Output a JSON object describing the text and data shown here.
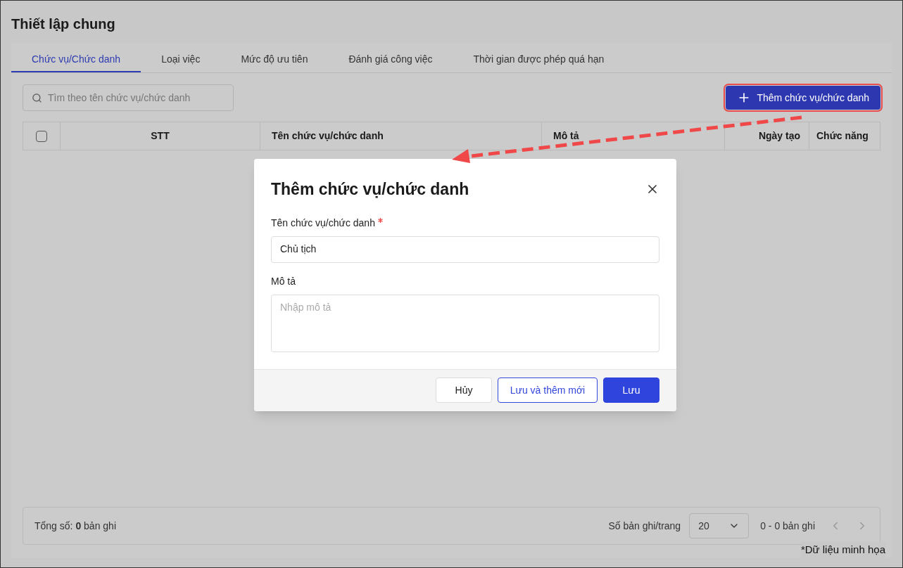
{
  "page_title": "Thiết lập chung",
  "tabs": [
    {
      "label": "Chức vụ/Chức danh",
      "selected": true
    },
    {
      "label": "Loại việc",
      "selected": false
    },
    {
      "label": "Mức độ ưu tiên",
      "selected": false
    },
    {
      "label": "Đánh giá công việc",
      "selected": false
    },
    {
      "label": "Thời gian được phép quá hạn",
      "selected": false
    }
  ],
  "search": {
    "placeholder": "Tìm theo tên chức vụ/chức danh"
  },
  "add_button": {
    "label": "Thêm chức vụ/chức danh",
    "highlighted": true
  },
  "table": {
    "select_all_checked": false,
    "columns": [
      {
        "label": "STT"
      },
      {
        "label": "Tên chức vụ/chức danh"
      },
      {
        "label": "Mô tả"
      },
      {
        "label": "Ngày tạo"
      },
      {
        "label": "Chức năng"
      }
    ]
  },
  "footer": {
    "total": "Tổng số: **0** bản ghi",
    "page_size_label": "Số bản ghi/trang",
    "page_size": "20",
    "range": "0 - 0 bản ghi"
  },
  "note": "*Dữ liệu minh họa",
  "dialog": {
    "title": "Thêm chức vụ/chức danh",
    "fields": [
      {
        "kind": "input",
        "label": "Tên chức vụ/chức danh",
        "required": true,
        "value": "Chủ tịch"
      },
      {
        "kind": "textarea",
        "label": "Mô tả",
        "required": false,
        "placeholder": "Nhập mô tả"
      }
    ],
    "buttons": [
      {
        "kind": "secondary",
        "label": "Hủy"
      },
      {
        "kind": "outline",
        "label": "Lưu và thêm mới"
      },
      {
        "kind": "primary",
        "label": "Lưu"
      }
    ]
  }
}
